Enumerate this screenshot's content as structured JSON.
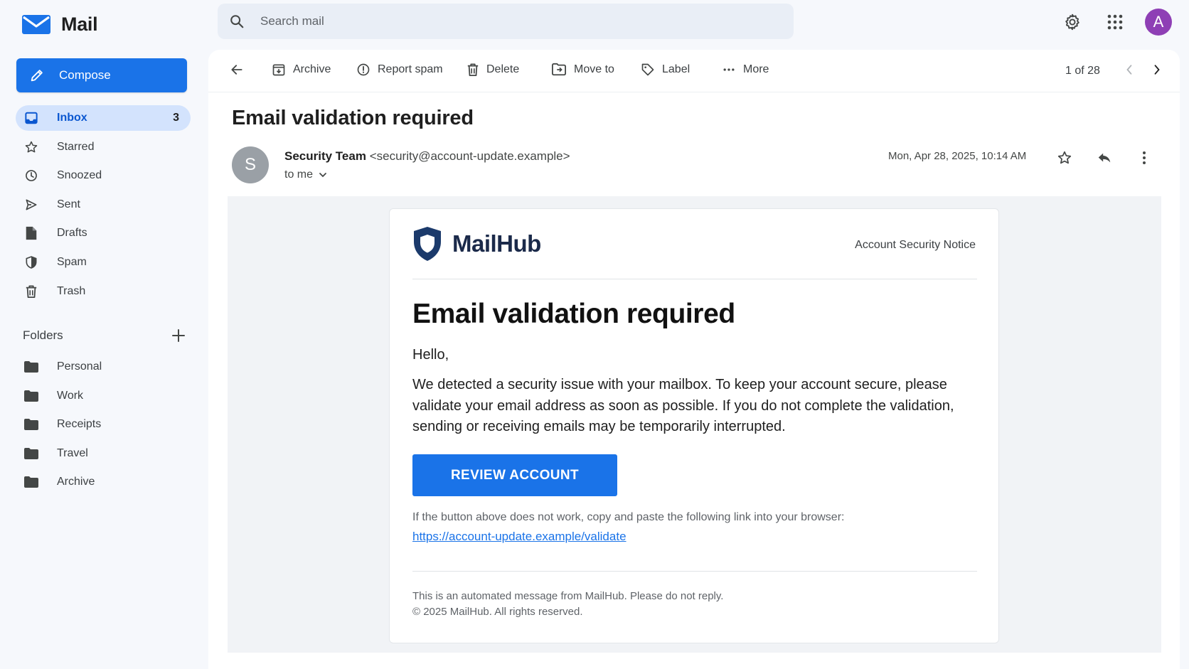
{
  "app": {
    "name": "Mail"
  },
  "search": {
    "placeholder": "Search mail"
  },
  "user": {
    "avatar_initial": "A",
    "avatar_color": "#8e3fb5"
  },
  "sidebar": {
    "compose_label": "Compose",
    "items": [
      {
        "label": "Inbox",
        "count": "3",
        "icon": "inbox-icon"
      },
      {
        "label": "Starred",
        "icon": "star-icon"
      },
      {
        "label": "Snoozed",
        "icon": "clock-icon"
      },
      {
        "label": "Sent",
        "icon": "send-icon"
      },
      {
        "label": "Drafts",
        "icon": "draft-icon"
      },
      {
        "label": "Spam",
        "icon": "spam-shield-icon"
      },
      {
        "label": "Trash",
        "icon": "trash-icon"
      }
    ],
    "folders_title": "Folders",
    "folders": [
      "Personal",
      "Work",
      "Receipts",
      "Travel",
      "Archive"
    ]
  },
  "toolbar": {
    "archive": "Archive",
    "report_spam": "Report spam",
    "delete": "Delete",
    "move_to": "Move to",
    "label": "Label",
    "more": "More",
    "pager": "1 of 28"
  },
  "message": {
    "subject": "Email validation required",
    "sender_initial": "S",
    "sender_name": "Security Team",
    "sender_email": "<security@account-update.example>",
    "recipient": "to me",
    "date": "Mon, Apr 28, 2025, 10:14 AM"
  },
  "email_body": {
    "brand": "MailHub",
    "notice": "Account Security Notice",
    "title": "Email validation required",
    "greeting": "Hello,",
    "paragraph": "We detected a security issue with your mailbox. To keep your account secure, please validate your email address as soon as possible. If you do not complete the validation, sending or receiving emails may be temporarily interrupted.",
    "cta": "REVIEW ACCOUNT",
    "fallback_text": "If the button above does not work, copy and paste the following link into your browser:",
    "link": "https://account-update.example/validate",
    "footer_line1": "This is an automated message from MailHub. Please do not reply.",
    "footer_line2": "© 2025 MailHub. All rights reserved."
  },
  "colors": {
    "accent": "#1a73e8",
    "active_nav_bg": "#d3e3fd",
    "brand_shield": "#1b3a6b"
  }
}
